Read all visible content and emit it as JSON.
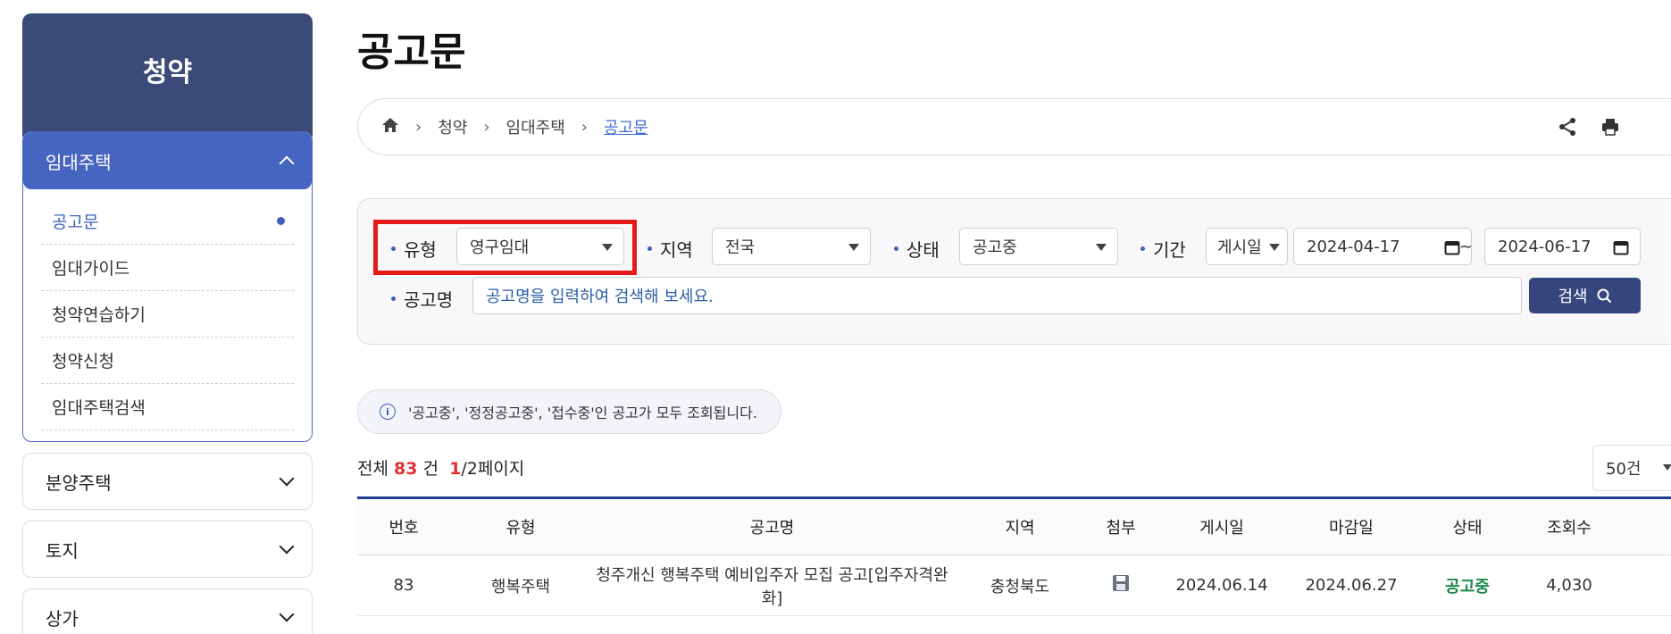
{
  "sidebar": {
    "title": "청약",
    "open_group": {
      "label": "임대주택",
      "items": [
        "공고문",
        "임대가이드",
        "청약연습하기",
        "청약신청",
        "임대주택검색"
      ]
    },
    "groups": [
      "분양주택",
      "토지",
      "상가"
    ]
  },
  "page_title": "공고문",
  "breadcrumb": {
    "items": [
      "청약",
      "임대주택"
    ],
    "current": "공고문"
  },
  "filters": {
    "type_label": "유형",
    "type_value": "영구임대",
    "region_label": "지역",
    "region_value": "전국",
    "status_label": "상태",
    "status_value": "공고중",
    "period_label": "기간",
    "period_basis": "게시일",
    "date_from": "2024-04-17",
    "tilde": "~",
    "date_to": "2024-06-17",
    "name_label": "공고명",
    "name_placeholder": "공고명을 입력하여 검색해 보세요.",
    "search_label": "검색"
  },
  "info_text": "'공고중', '정정공고중', '접수중'인 공고가 모두 조회됩니다.",
  "summary": {
    "prefix": "전체",
    "total": "83",
    "unit": "건",
    "page_current": "1",
    "page_rest": "/2페이지"
  },
  "per_page": "50건",
  "table": {
    "headers": [
      "번호",
      "유형",
      "공고명",
      "지역",
      "첨부",
      "게시일",
      "마감일",
      "상태",
      "조회수"
    ],
    "rows": [
      {
        "no": "83",
        "type": "행복주택",
        "name": "청주개신 행복주택 예비입주자 모집 공고[입주자격완화]",
        "region": "충청북도",
        "posted": "2024.06.14",
        "deadline": "2024.06.27",
        "status": "공고중",
        "views": "4,030"
      }
    ]
  },
  "colors": {
    "sidebar_head": "#3a4a79",
    "sidebar_active": "#4565c1",
    "accent": "#3e5fbd",
    "highlight": "#e41a1a",
    "status_green": "#1c8a4b"
  }
}
